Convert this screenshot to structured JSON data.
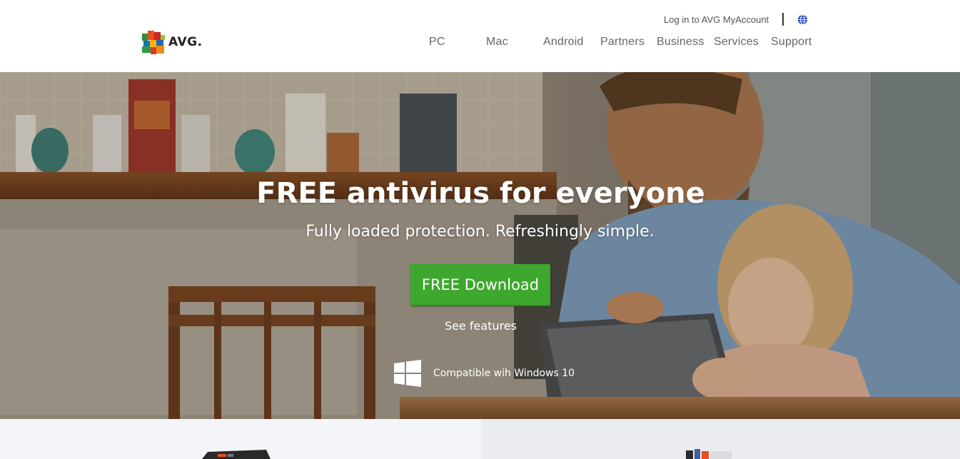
{
  "brand": {
    "name": "AVG."
  },
  "header": {
    "login": "Log in to AVG MyAccount",
    "nav": [
      "PC",
      "Mac",
      "Android",
      "Partners",
      "Business",
      "Services",
      "Support"
    ]
  },
  "hero": {
    "title": "FREE antivirus for everyone",
    "subtitle": "Fully loaded protection. Refreshingly simple.",
    "download_label": "FREE Download",
    "features_label": "See features",
    "compat_text": "Compatible wih Windows 10"
  },
  "colors": {
    "accent_green": "#3ea72d",
    "nav_text": "#666666",
    "hero_text": "#ffffff"
  },
  "icons": {
    "globe": "globe-icon",
    "windows": "windows-logo-icon"
  }
}
